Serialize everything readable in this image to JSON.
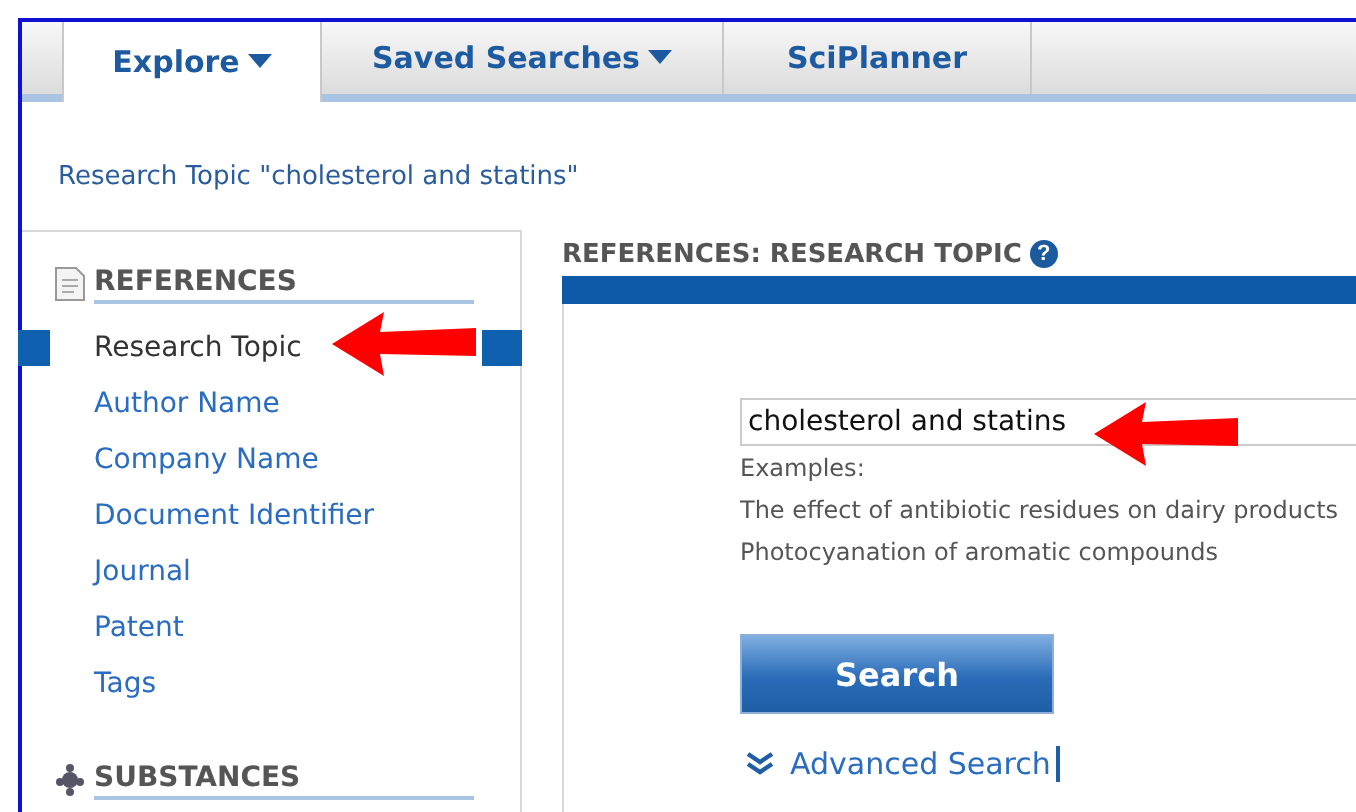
{
  "tabs": [
    {
      "label": "Explore",
      "dropdown": true,
      "selected": true
    },
    {
      "label": "Saved Searches",
      "dropdown": true,
      "selected": false
    },
    {
      "label": "SciPlanner",
      "dropdown": false,
      "selected": false
    }
  ],
  "breadcrumb": "Research Topic \"cholesterol and statins\"",
  "sidebar": {
    "sections": [
      {
        "kind": "references",
        "title": "REFERENCES",
        "items": [
          {
            "label": "Research Topic",
            "selected": true
          },
          {
            "label": "Author Name",
            "selected": false
          },
          {
            "label": "Company Name",
            "selected": false
          },
          {
            "label": "Document Identifier",
            "selected": false
          },
          {
            "label": "Journal",
            "selected": false
          },
          {
            "label": "Patent",
            "selected": false
          },
          {
            "label": "Tags",
            "selected": false
          }
        ]
      },
      {
        "kind": "substances",
        "title": "SUBSTANCES"
      }
    ]
  },
  "panel": {
    "title": "REFERENCES: RESEARCH TOPIC",
    "help": "?",
    "query": {
      "value": "cholesterol and statins"
    },
    "examples_label": "Examples:",
    "examples": [
      "The effect of antibiotic residues on dairy products",
      "Photocyanation of aromatic compounds"
    ],
    "search_button": "Search",
    "advanced_link": "Advanced Search"
  }
}
